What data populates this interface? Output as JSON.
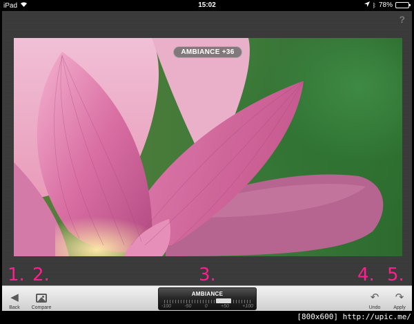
{
  "status_bar": {
    "device": "iPad",
    "time": "15:02",
    "battery": "78%",
    "battery_level": 0.78
  },
  "help": {
    "label": "?"
  },
  "adjustment_overlay": {
    "label": "AMBIANCE +36"
  },
  "annotations": [
    "1.",
    "2.",
    "3.",
    "4.",
    "5."
  ],
  "toolbar": {
    "back_label": "Back",
    "compare_label": "Compare",
    "undo_label": "Undo",
    "apply_label": "Apply",
    "slider": {
      "title": "AMBIANCE",
      "value": 36,
      "min": -100,
      "max": 100,
      "scale": [
        "-100",
        "-50",
        "0",
        "+50",
        "+100"
      ]
    }
  },
  "watermark": "[800x600] http://upic.me/",
  "colors": {
    "annotation": "#ff1f8f",
    "background": "#3a3a3a",
    "toolbar": "#e0e0e0"
  },
  "icons": {
    "back": "back-triangle-icon",
    "compare": "image-icon",
    "undo": "undo-arrow-icon",
    "apply": "apply-arrow-icon"
  }
}
